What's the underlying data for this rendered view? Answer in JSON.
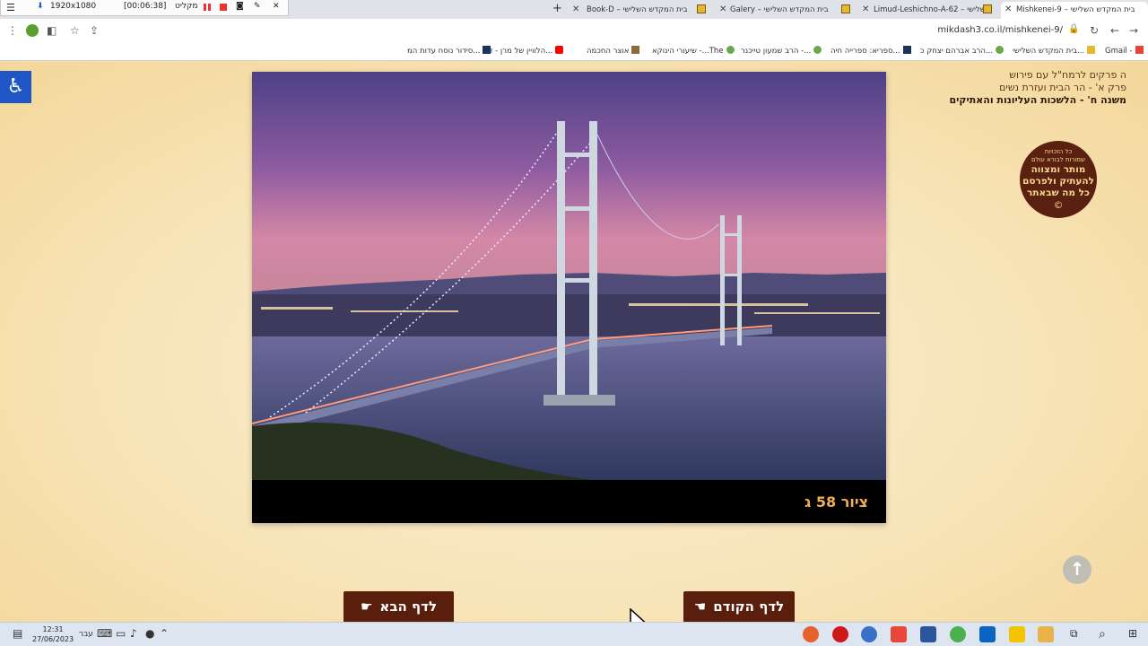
{
  "recorder": {
    "resolution": "1920x1080",
    "label": "מקליט",
    "time": "[00:06:38]"
  },
  "tabs": [
    {
      "title": "Mishkenei-9 – בית המקדש השלישי",
      "active": true
    },
    {
      "title": "Limud-Leshichno-A-62 – השלישי",
      "active": false
    },
    {
      "title": "Galery – בית המקדש השלישי",
      "active": false
    },
    {
      "title": "Book-D – בית המקדש השלישי",
      "active": false
    }
  ],
  "address_bar": {
    "url": "mikdash3.co.il/mishkenei-9/"
  },
  "bookmarks": [
    {
      "label": "Gmail -",
      "icon": "gmail-icon"
    },
    {
      "label": "בית המקדש השלישי...",
      "icon": "mikdash-icon"
    },
    {
      "label": "הרב אברהם יצחק כ...",
      "icon": "leaf-icon"
    },
    {
      "label": "ספריא: ספרייה חיה...",
      "icon": "sefaria-icon"
    },
    {
      "label": "הרב שמעון טייכנר -...",
      "icon": "leaf-icon"
    },
    {
      "label": "שיעורי הינוקא -...The",
      "icon": "leaf-icon"
    },
    {
      "label": "אוצר החכמה",
      "icon": "book-icon"
    },
    {
      "label": "הלוויין של מרן - דר...",
      "icon": "youtube-icon"
    },
    {
      "label": "סידור נוסח עדות המ...",
      "icon": "siddur-icon"
    }
  ],
  "page": {
    "heading_lines": [
      "ה פרקים לרמח\"ל עם פירוש",
      "פרק א' - הר הבית ועזרת נשים",
      "משנה ח' - הלשכות העליונות והאתיקים"
    ],
    "copyright_badge": {
      "small_lines": [
        "כל הזכויות",
        "שמורות לבורא עולם"
      ],
      "main_lines": [
        "מותר ומצווה",
        "להעתיק ולפרסם",
        "כל מה שבאתר"
      ],
      "symbol": "©"
    },
    "image_caption": "ציור 58 ג",
    "next_button": "לדף הבא",
    "prev_button": "לדף הקודם"
  },
  "taskbar": {
    "time": "12:31",
    "date": "27/06/2023",
    "language": "עבר"
  },
  "colors": {
    "page_background": "#f7e4b8",
    "button_background": "#5a1e0c",
    "caption_color": "#f0b050",
    "accessibility_blue": "#1f56c5"
  }
}
